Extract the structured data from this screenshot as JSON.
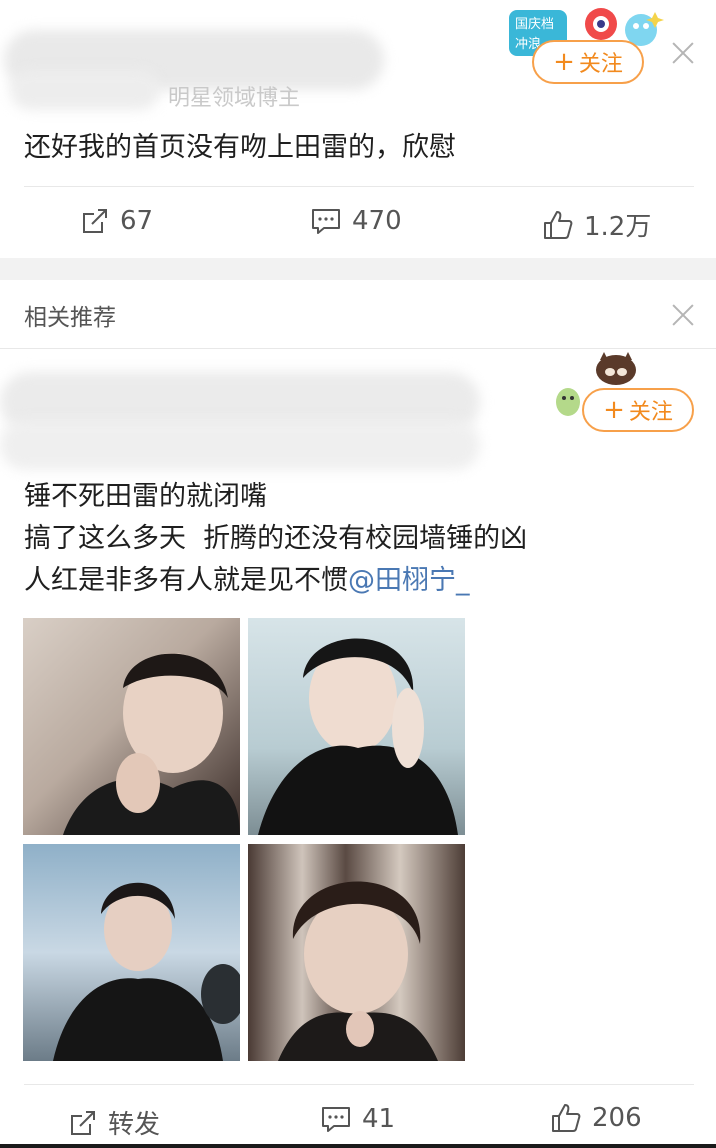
{
  "post1": {
    "author_suffix": "明星领域博主",
    "text": "还好我的首页没有吻上田雷的，欣慰",
    "follow_label": "关注",
    "badge_text": "国庆档 冲浪",
    "actions": {
      "repost_count": "67",
      "comment_count": "470",
      "like_count": "1.2万"
    }
  },
  "related": {
    "title": "相关推荐"
  },
  "post2": {
    "follow_label": "关注",
    "text_line1": "锤不死田雷的就闭嘴",
    "text_line2": "搞了这么多天  折腾的还没有校园墙锤的凶",
    "text_line3_prefix": "人红是非多有人就是见不惯",
    "mention": "@田栩宁_",
    "actions": {
      "repost_label": "转发",
      "comment_count": "41",
      "like_count": "206"
    }
  },
  "icons": [
    "repost-icon",
    "comment-icon",
    "like-icon",
    "close-icon",
    "plus-icon"
  ],
  "colors": {
    "follow_orange": "#f28a1e",
    "mention_blue": "#4a78b3",
    "section_gap": "#f2f2f2"
  }
}
